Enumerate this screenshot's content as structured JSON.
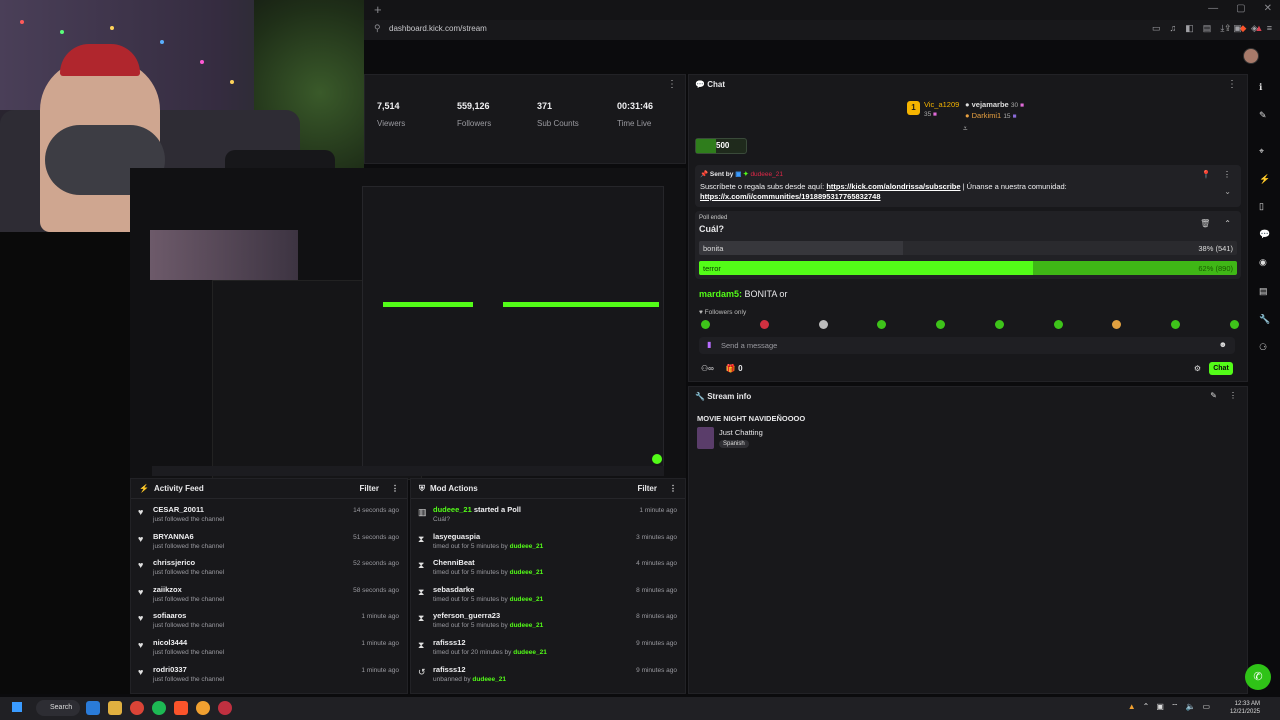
{
  "browser": {
    "url": "dashboard.kick.com/stream",
    "new_tab_icon": "plus-icon"
  },
  "stats": [
    {
      "value": "7,514",
      "label": "Viewers"
    },
    {
      "value": "559,126",
      "label": "Followers"
    },
    {
      "value": "371",
      "label": "Sub Counts"
    },
    {
      "value": "00:31:46",
      "label": "Time Live"
    }
  ],
  "activity_feed": {
    "title": "Activity Feed",
    "filter_label": "Filter",
    "items": [
      {
        "name": "CESAR_20011",
        "sub": "just followed the channel",
        "time": "14 seconds ago"
      },
      {
        "name": "BRYANNA6",
        "sub": "just followed the channel",
        "time": "51 seconds ago"
      },
      {
        "name": "chrissjerico",
        "sub": "just followed the channel",
        "time": "52 seconds ago"
      },
      {
        "name": "zaiikzox",
        "sub": "just followed the channel",
        "time": "58 seconds ago"
      },
      {
        "name": "sofiaaros",
        "sub": "just followed the channel",
        "time": "1 minute ago"
      },
      {
        "name": "nicol3444",
        "sub": "just followed the channel",
        "time": "1 minute ago"
      },
      {
        "name": "rodri0337",
        "sub": "just followed the channel",
        "time": "1 minute ago"
      }
    ]
  },
  "mod_actions": {
    "title": "Mod Actions",
    "filter_label": "Filter",
    "items": [
      {
        "icon": "poll-icon",
        "name": "dudeee_21",
        "action": "started a Poll",
        "sub": "Cuál?",
        "by": "",
        "time": "1 minute ago",
        "name_green": true
      },
      {
        "icon": "hourglass-icon",
        "name": "lasyeguaspia",
        "action": "",
        "sub": "timed out for 5 minutes by ",
        "by": "dudeee_21",
        "time": "3 minutes ago",
        "name_green": false
      },
      {
        "icon": "hourglass-icon",
        "name": "ChenniBeat",
        "action": "",
        "sub": "timed out for 5 minutes by ",
        "by": "dudeee_21",
        "time": "4 minutes ago",
        "name_green": false
      },
      {
        "icon": "hourglass-icon",
        "name": "sebasdarke",
        "action": "",
        "sub": "timed out for 5 minutes by ",
        "by": "dudeee_21",
        "time": "8 minutes ago",
        "name_green": false
      },
      {
        "icon": "hourglass-icon",
        "name": "yeferson_guerra23",
        "action": "",
        "sub": "timed out for 5 minutes by ",
        "by": "dudeee_21",
        "time": "8 minutes ago",
        "name_green": false
      },
      {
        "icon": "hourglass-icon",
        "name": "rafisss12",
        "action": "",
        "sub": "timed out for 20 minutes by ",
        "by": "dudeee_21",
        "time": "9 minutes ago",
        "name_green": false
      },
      {
        "icon": "undo-icon",
        "name": "rafisss12",
        "action": "",
        "sub": "unbanned by ",
        "by": "dudeee_21",
        "time": "9 minutes ago",
        "name_green": false
      }
    ]
  },
  "chat": {
    "title": "Chat",
    "leaderboard": {
      "first": {
        "name": "Vic_a1209",
        "count": "35",
        "rank": "1"
      },
      "second": {
        "name": "vejamarbe",
        "count": "30"
      },
      "third": {
        "name": "Darkimi1",
        "count": "15"
      }
    },
    "goal_value": "500",
    "pinned": {
      "sent_by_label": "Sent by",
      "sender": "dudeee_21",
      "text": "Suscríbete o regala subs desde aquí: ",
      "link1": "https://kick.com/alondrissa/subscribe",
      "middle": " | Únanse a nuestra comunidad: ",
      "link2": "https://x.com/i/communities/1918895317765832748"
    },
    "poll": {
      "status": "Poll ended",
      "question": "Cuál?",
      "options": [
        {
          "label": "bonita",
          "result": "38% (541)",
          "share": 0.38,
          "winner": false
        },
        {
          "label": "terror",
          "result": "62% (890)",
          "share": 0.62,
          "winner": true
        }
      ]
    },
    "message": {
      "user": "mardam5:",
      "text": " BONITA or"
    },
    "followers_only": "Followers only",
    "input_placeholder": "Send a message",
    "footer_count": "0",
    "chat_button": "Chat"
  },
  "stream_info": {
    "title_label": "Stream info",
    "stream_title": "MOVIE NIGHT NAVIDEÑOOOO",
    "category": "Just Chatting",
    "tag": "Spanish"
  },
  "taskbar": {
    "search_label": "Search",
    "time": "12:33 AM",
    "date": "12/21/2025"
  },
  "colors": {
    "accent": "#53fc18",
    "panel": "#18181b",
    "background": "#0b0b0d"
  }
}
